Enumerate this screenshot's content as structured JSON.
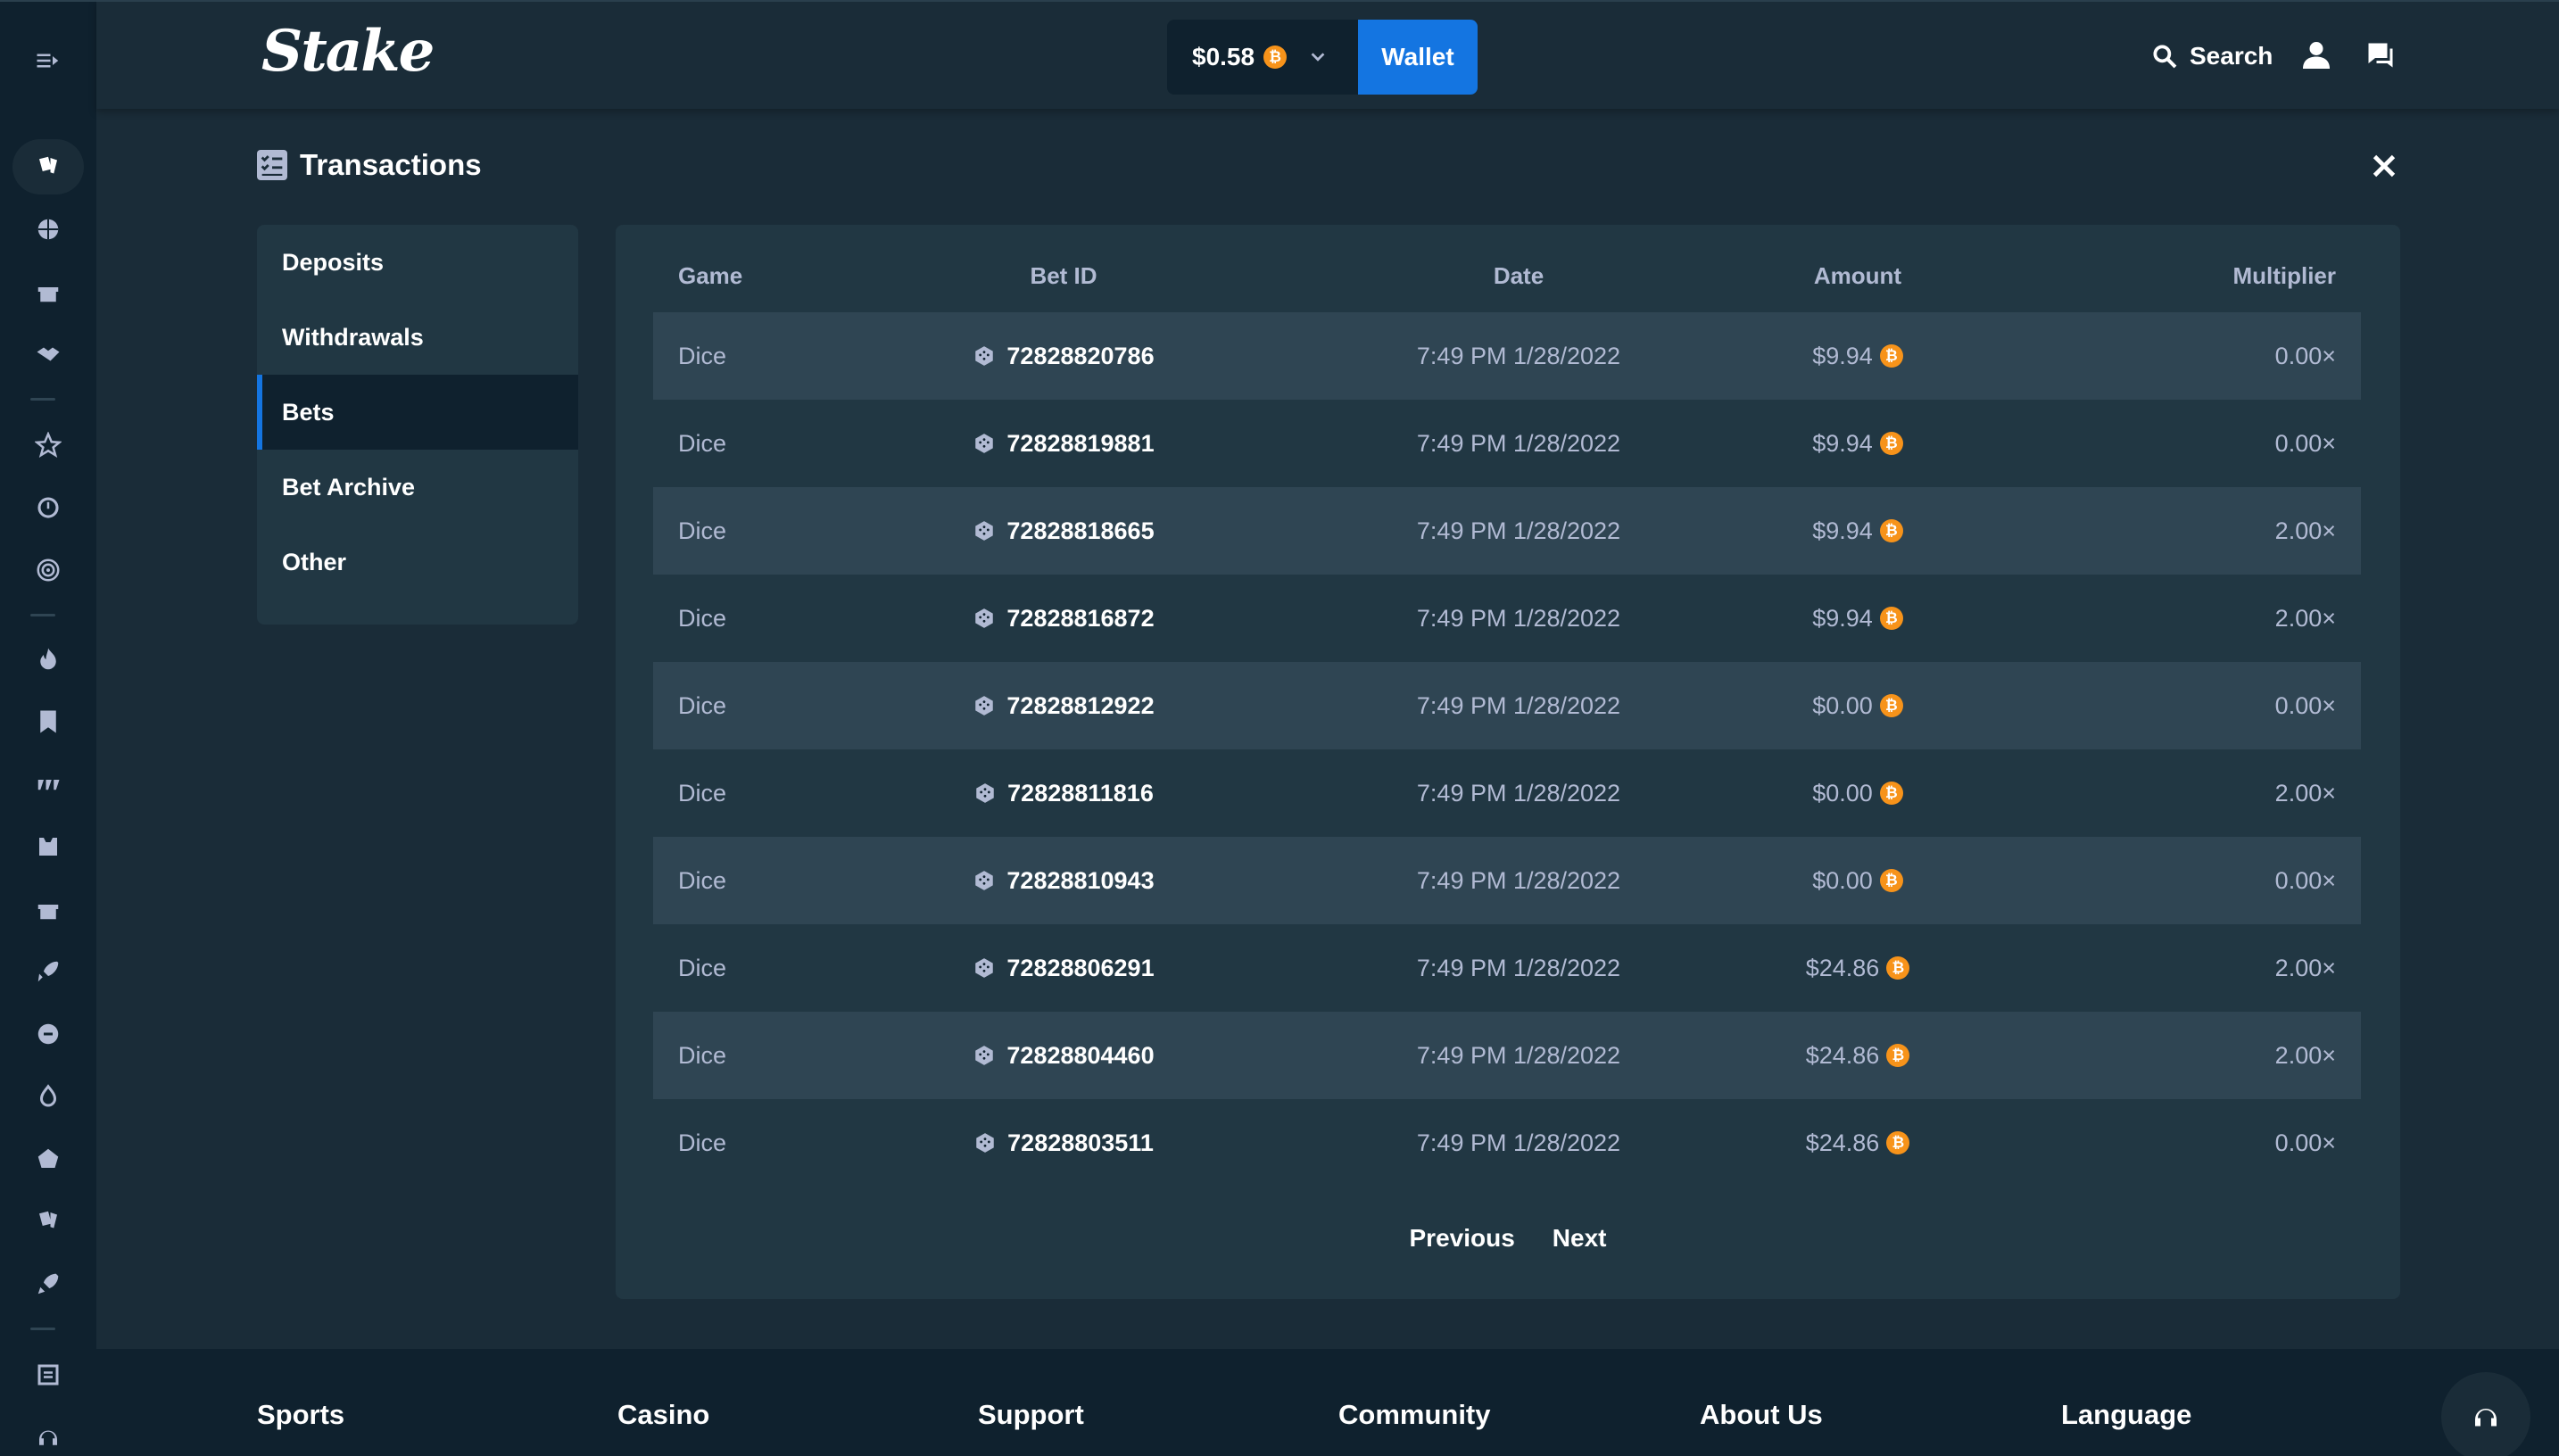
{
  "header": {
    "logo": "Stake",
    "balance": "$0.58",
    "wallet_label": "Wallet",
    "search_label": "Search"
  },
  "page": {
    "title": "Transactions"
  },
  "tabs": [
    {
      "label": "Deposits",
      "active": false
    },
    {
      "label": "Withdrawals",
      "active": false
    },
    {
      "label": "Bets",
      "active": true
    },
    {
      "label": "Bet Archive",
      "active": false
    },
    {
      "label": "Other",
      "active": false
    }
  ],
  "table": {
    "headers": {
      "game": "Game",
      "bet_id": "Bet ID",
      "date": "Date",
      "amount": "Amount",
      "multiplier": "Multiplier"
    },
    "rows": [
      {
        "game": "Dice",
        "bet_id": "72828820786",
        "date": "7:49 PM 1/28/2022",
        "amount": "$9.94",
        "multiplier": "0.00×"
      },
      {
        "game": "Dice",
        "bet_id": "72828819881",
        "date": "7:49 PM 1/28/2022",
        "amount": "$9.94",
        "multiplier": "0.00×"
      },
      {
        "game": "Dice",
        "bet_id": "72828818665",
        "date": "7:49 PM 1/28/2022",
        "amount": "$9.94",
        "multiplier": "2.00×"
      },
      {
        "game": "Dice",
        "bet_id": "72828816872",
        "date": "7:49 PM 1/28/2022",
        "amount": "$9.94",
        "multiplier": "2.00×"
      },
      {
        "game": "Dice",
        "bet_id": "72828812922",
        "date": "7:49 PM 1/28/2022",
        "amount": "$0.00",
        "multiplier": "0.00×"
      },
      {
        "game": "Dice",
        "bet_id": "72828811816",
        "date": "7:49 PM 1/28/2022",
        "amount": "$0.00",
        "multiplier": "2.00×"
      },
      {
        "game": "Dice",
        "bet_id": "72828810943",
        "date": "7:49 PM 1/28/2022",
        "amount": "$0.00",
        "multiplier": "0.00×"
      },
      {
        "game": "Dice",
        "bet_id": "72828806291",
        "date": "7:49 PM 1/28/2022",
        "amount": "$24.86",
        "multiplier": "2.00×"
      },
      {
        "game": "Dice",
        "bet_id": "72828804460",
        "date": "7:49 PM 1/28/2022",
        "amount": "$24.86",
        "multiplier": "2.00×"
      },
      {
        "game": "Dice",
        "bet_id": "72828803511",
        "date": "7:49 PM 1/28/2022",
        "amount": "$24.86",
        "multiplier": "0.00×"
      }
    ]
  },
  "pager": {
    "previous": "Previous",
    "next": "Next"
  },
  "footer": {
    "sports": "Sports",
    "casino": "Casino",
    "support": "Support",
    "community": "Community",
    "about": "About Us",
    "language": "Language"
  },
  "colors": {
    "bg": "#1a2c38",
    "rail": "#0f212e",
    "card": "#213743",
    "row_alt": "#2f4553",
    "accent": "#1475e1",
    "coin": "#f7931a",
    "muted_text": "#b1bad3"
  },
  "icons": {
    "rail": [
      "expand-menu-icon",
      "casino-cards-icon",
      "basketball-icon",
      "gift-icon",
      "handshake-icon",
      "star-icon",
      "history-icon",
      "target-icon",
      "fire-icon",
      "bookmark-star-icon",
      "slots-icon",
      "live-casino-icon",
      "promotions-gift-icon",
      "rocket-icon",
      "game-shows-icon",
      "flame-icon",
      "poker-chip-icon",
      "cards-icon",
      "rocket-small-icon",
      "blog-icon",
      "headset-icon"
    ],
    "coin": "bitcoin-coin-icon",
    "dice": "dice-icon"
  }
}
